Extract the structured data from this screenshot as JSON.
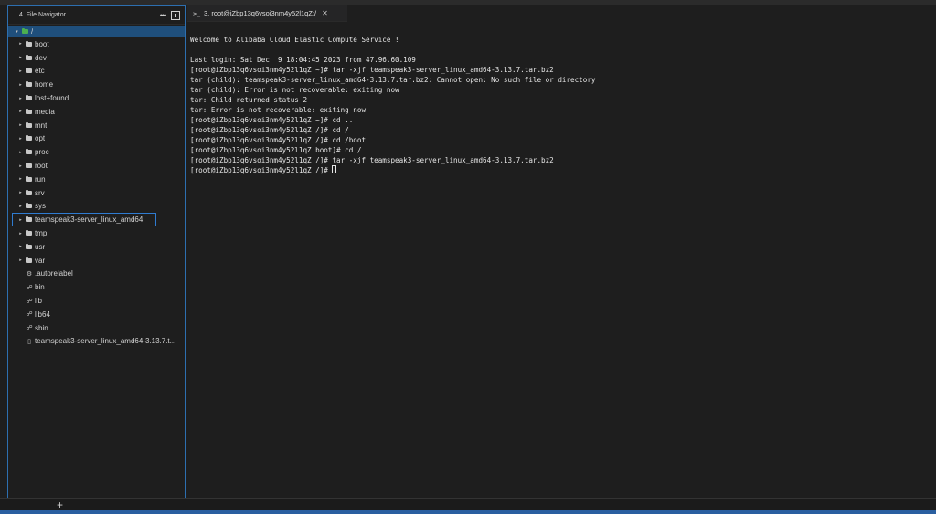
{
  "navigator": {
    "title": "4. File Navigator",
    "more_label": "•••",
    "root": {
      "toggle": "▾",
      "label": "/"
    },
    "folders": [
      {
        "label": "boot"
      },
      {
        "label": "dev"
      },
      {
        "label": "etc"
      },
      {
        "label": "home"
      },
      {
        "label": "lost+found"
      },
      {
        "label": "media"
      },
      {
        "label": "mnt"
      },
      {
        "label": "opt"
      },
      {
        "label": "proc"
      },
      {
        "label": "root"
      },
      {
        "label": "run"
      },
      {
        "label": "srv"
      },
      {
        "label": "sys"
      },
      {
        "label": "teamspeak3-server_linux_amd64",
        "selected": true
      },
      {
        "label": "tmp"
      },
      {
        "label": "usr"
      },
      {
        "label": "var"
      }
    ],
    "files": [
      {
        "label": ".autorelabel",
        "icon": "gear-icon",
        "glyph": "⚙"
      },
      {
        "label": "bin",
        "icon": "link-icon",
        "glyph": "☍"
      },
      {
        "label": "lib",
        "icon": "link-icon",
        "glyph": "☍"
      },
      {
        "label": "lib64",
        "icon": "link-icon",
        "glyph": "☍"
      },
      {
        "label": "sbin",
        "icon": "link-icon",
        "glyph": "☍"
      },
      {
        "label": "teamspeak3-server_linux_amd64-3.13.7.t...",
        "icon": "file-icon",
        "glyph": "▯"
      }
    ],
    "collapsed_toggle": "▸"
  },
  "terminal": {
    "tab_prompt": ">_",
    "tab_title": "3. root@iZbp13q6vsoi3nm4y52l1qZ:/",
    "tab_close": "✕",
    "lines": [
      "Welcome to Alibaba Cloud Elastic Compute Service !",
      "",
      "Last login: Sat Dec  9 18:04:45 2023 from 47.96.60.109",
      "[root@iZbp13q6vsoi3nm4y52l1qZ ~]# tar -xjf teamspeak3-server_linux_amd64-3.13.7.tar.bz2",
      "tar (child): teamspeak3-server_linux_amd64-3.13.7.tar.bz2: Cannot open: No such file or directory",
      "tar (child): Error is not recoverable: exiting now",
      "tar: Child returned status 2",
      "tar: Error is not recoverable: exiting now",
      "[root@iZbp13q6vsoi3nm4y52l1qZ ~]# cd ..",
      "[root@iZbp13q6vsoi3nm4y52l1qZ /]# cd /",
      "[root@iZbp13q6vsoi3nm4y52l1qZ /]# cd /boot",
      "[root@iZbp13q6vsoi3nm4y52l1qZ boot]# cd /",
      "[root@iZbp13q6vsoi3nm4y52l1qZ /]# tar -xjf teamspeak3-server_linux_amd64-3.13.7.tar.bz2",
      "[root@iZbp13q6vsoi3nm4y52l1qZ /]# "
    ]
  },
  "bottom": {
    "add_label": "+"
  },
  "colors": {
    "accent": "#2f7bd0",
    "selection_bg": "#1f4f7c",
    "root_folder": "#4caf50"
  }
}
